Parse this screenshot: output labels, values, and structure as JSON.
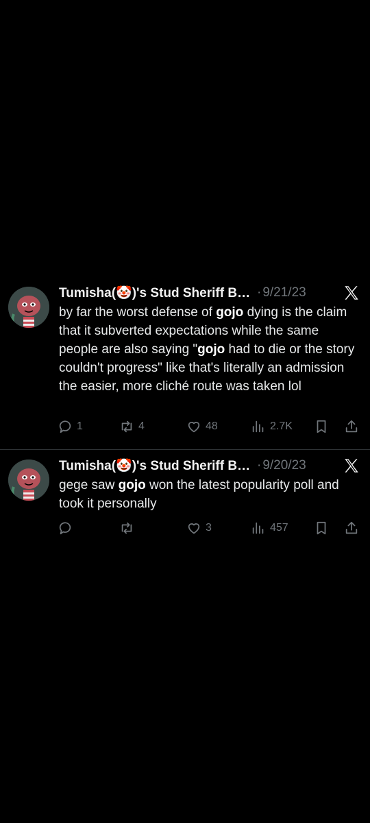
{
  "tweets": [
    {
      "name": "Tumisha(🤡)'s Stud Sheriff Boi...",
      "separator": "·",
      "date": "9/21/23",
      "text_parts": [
        {
          "t": "by far the worst defense of ",
          "b": false
        },
        {
          "t": "gojo",
          "b": true
        },
        {
          "t": " dying is the claim that it subverted expectations while the same people are also saying \"",
          "b": false
        },
        {
          "t": "gojo",
          "b": true
        },
        {
          "t": " had to die or the story couldn't progress\" like that's literally an admission the easier, more cliché route was taken lol",
          "b": false
        }
      ],
      "replies": "1",
      "retweets": "4",
      "likes": "48",
      "views": "2.7K"
    },
    {
      "name": "Tumisha(🤡)'s Stud Sheriff Bo...",
      "separator": "·",
      "date": "9/20/23",
      "text_parts": [
        {
          "t": "gege saw ",
          "b": false
        },
        {
          "t": "gojo",
          "b": true
        },
        {
          "t": " won the latest popularity poll and took it personally",
          "b": false
        }
      ],
      "replies": "",
      "retweets": "",
      "likes": "3",
      "views": "457"
    }
  ],
  "icons": {
    "reply": "reply-icon",
    "retweet": "retweet-icon",
    "like": "heart-icon",
    "views": "views-icon",
    "bookmark": "bookmark-icon",
    "share": "share-icon",
    "logo": "x-logo-icon"
  },
  "colors": {
    "background": "#000000",
    "text": "#e7e9ea",
    "muted": "#71767b",
    "divider": "#2f3336"
  }
}
